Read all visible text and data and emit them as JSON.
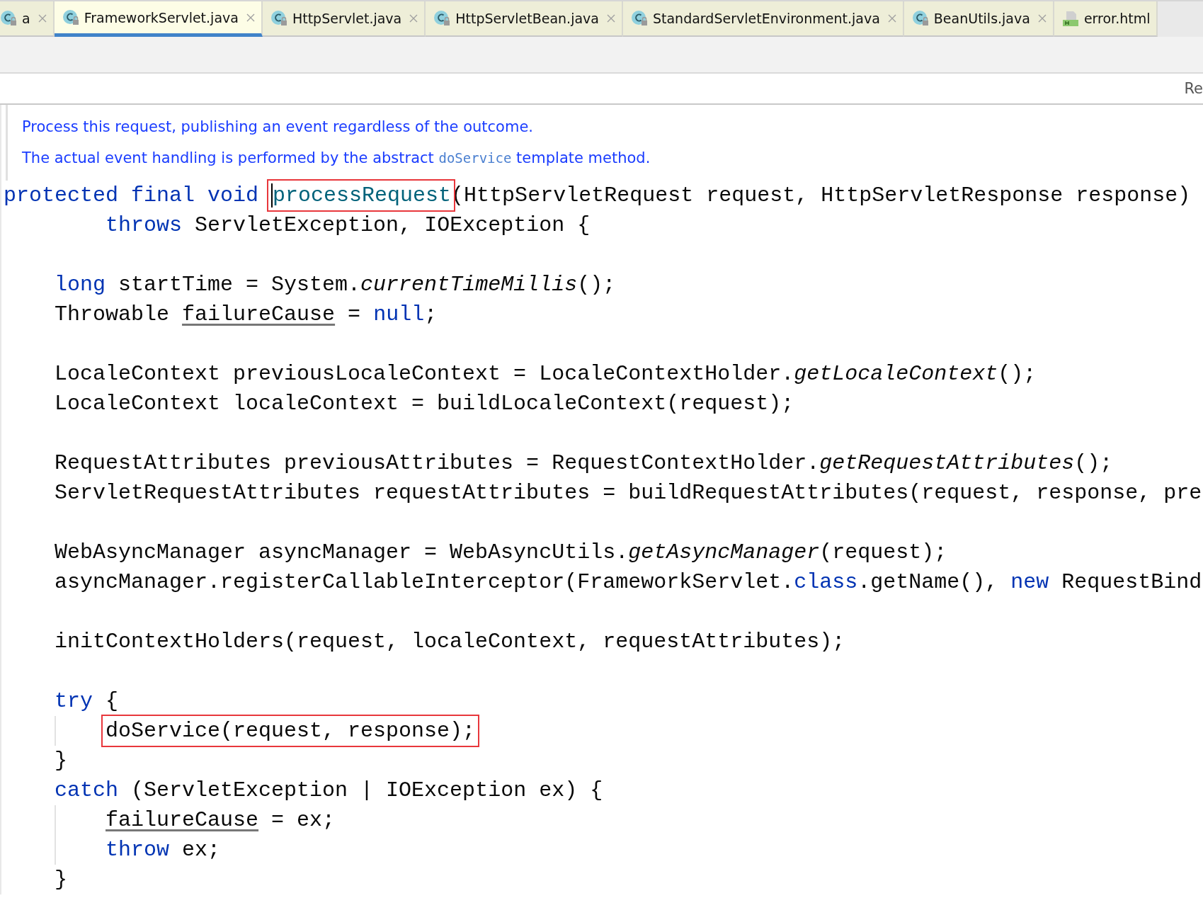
{
  "tabs": [
    {
      "label": "a",
      "kind": "class",
      "selected": false,
      "show_close": true
    },
    {
      "label": "FrameworkServlet.java",
      "kind": "class",
      "selected": true,
      "show_close": true
    },
    {
      "label": "HttpServlet.java",
      "kind": "class",
      "selected": false,
      "show_close": true
    },
    {
      "label": "HttpServletBean.java",
      "kind": "class",
      "selected": false,
      "show_close": true
    },
    {
      "label": "StandardServletEnvironment.java",
      "kind": "class",
      "selected": false,
      "show_close": true
    },
    {
      "label": "BeanUtils.java",
      "kind": "class",
      "selected": false,
      "show_close": true
    },
    {
      "label": "error.html",
      "kind": "html",
      "selected": false,
      "show_close": false
    }
  ],
  "info_bar": {
    "text": "Re"
  },
  "doc_comment": [
    [
      {
        "text": "Process this request, publishing an event regardless of the outcome.",
        "code": false
      }
    ],
    [
      {
        "text": "The actual event handling is performed by the abstract ",
        "code": false
      },
      {
        "text": "doService",
        "code": true
      },
      {
        "text": " template method.",
        "code": false
      }
    ]
  ],
  "code_lines": [
    {
      "kind": "code",
      "guide": false,
      "tokens": [
        {
          "text": "protected final void ",
          "kind": "keyword"
        },
        {
          "text": "processRequest",
          "kind": "method",
          "boxed": true,
          "caret": true
        },
        {
          "text": "(HttpServletRequest request, HttpServletResponse response)",
          "kind": "plain"
        }
      ]
    },
    {
      "kind": "code",
      "guide": false,
      "tokens": [
        {
          "text": "        throws",
          "kind": "keyword"
        },
        {
          "text": " ServletException, IOException {",
          "kind": "plain"
        }
      ]
    },
    {
      "kind": "blank"
    },
    {
      "kind": "code",
      "guide": false,
      "tokens": [
        {
          "text": "    long",
          "kind": "keyword"
        },
        {
          "text": " startTime = System.",
          "kind": "plain"
        },
        {
          "text": "currentTimeMillis",
          "kind": "static"
        },
        {
          "text": "();",
          "kind": "plain"
        }
      ]
    },
    {
      "kind": "code",
      "guide": false,
      "tokens": [
        {
          "text": "    Throwable ",
          "kind": "plain"
        },
        {
          "text": "failureCause",
          "kind": "reassigned"
        },
        {
          "text": " = ",
          "kind": "plain"
        },
        {
          "text": "null",
          "kind": "keyword"
        },
        {
          "text": ";",
          "kind": "plain"
        }
      ]
    },
    {
      "kind": "blank"
    },
    {
      "kind": "code",
      "guide": false,
      "tokens": [
        {
          "text": "    LocaleContext previousLocaleContext = LocaleContextHolder.",
          "kind": "plain"
        },
        {
          "text": "getLocaleContext",
          "kind": "static"
        },
        {
          "text": "();",
          "kind": "plain"
        }
      ]
    },
    {
      "kind": "code",
      "guide": false,
      "tokens": [
        {
          "text": "    LocaleContext localeContext = buildLocaleContext(request);",
          "kind": "plain"
        }
      ]
    },
    {
      "kind": "blank"
    },
    {
      "kind": "code",
      "guide": false,
      "tokens": [
        {
          "text": "    RequestAttributes previousAttributes = RequestContextHolder.",
          "kind": "plain"
        },
        {
          "text": "getRequestAttributes",
          "kind": "static"
        },
        {
          "text": "();",
          "kind": "plain"
        }
      ]
    },
    {
      "kind": "code",
      "guide": false,
      "tokens": [
        {
          "text": "    ServletRequestAttributes requestAttributes = buildRequestAttributes(request, response, pre",
          "kind": "plain"
        }
      ]
    },
    {
      "kind": "blank"
    },
    {
      "kind": "code",
      "guide": false,
      "tokens": [
        {
          "text": "    WebAsyncManager asyncManager = WebAsyncUtils.",
          "kind": "plain"
        },
        {
          "text": "getAsyncManager",
          "kind": "static"
        },
        {
          "text": "(request);",
          "kind": "plain"
        }
      ]
    },
    {
      "kind": "code",
      "guide": false,
      "tokens": [
        {
          "text": "    asyncManager.registerCallableInterceptor(FrameworkServlet.",
          "kind": "plain"
        },
        {
          "text": "class",
          "kind": "keyword"
        },
        {
          "text": ".getName(), ",
          "kind": "plain"
        },
        {
          "text": "new",
          "kind": "keyword"
        },
        {
          "text": " RequestBind",
          "kind": "plain"
        }
      ]
    },
    {
      "kind": "blank"
    },
    {
      "kind": "code",
      "guide": false,
      "tokens": [
        {
          "text": "    initContextHolders(request, localeContext, requestAttributes);",
          "kind": "plain"
        }
      ]
    },
    {
      "kind": "blank"
    },
    {
      "kind": "code",
      "guide": false,
      "tokens": [
        {
          "text": "    try",
          "kind": "keyword"
        },
        {
          "text": " {",
          "kind": "plain"
        }
      ]
    },
    {
      "kind": "code",
      "guide": true,
      "tokens": [
        {
          "text": "        doService(request, response);",
          "kind": "plain",
          "boxed": true
        }
      ]
    },
    {
      "kind": "code",
      "guide": false,
      "tokens": [
        {
          "text": "    }",
          "kind": "plain"
        }
      ]
    },
    {
      "kind": "code",
      "guide": false,
      "tokens": [
        {
          "text": "    catch",
          "kind": "keyword"
        },
        {
          "text": " (ServletException | IOException ex) {",
          "kind": "plain"
        }
      ]
    },
    {
      "kind": "code",
      "guide": true,
      "tokens": [
        {
          "text": "        failureCause",
          "kind": "reassigned"
        },
        {
          "text": " = ex;",
          "kind": "plain"
        }
      ]
    },
    {
      "kind": "code",
      "guide": true,
      "tokens": [
        {
          "text": "        throw",
          "kind": "keyword"
        },
        {
          "text": " ex;",
          "kind": "plain"
        }
      ]
    },
    {
      "kind": "code",
      "guide": false,
      "tokens": [
        {
          "text": "    }",
          "kind": "plain"
        }
      ]
    }
  ]
}
